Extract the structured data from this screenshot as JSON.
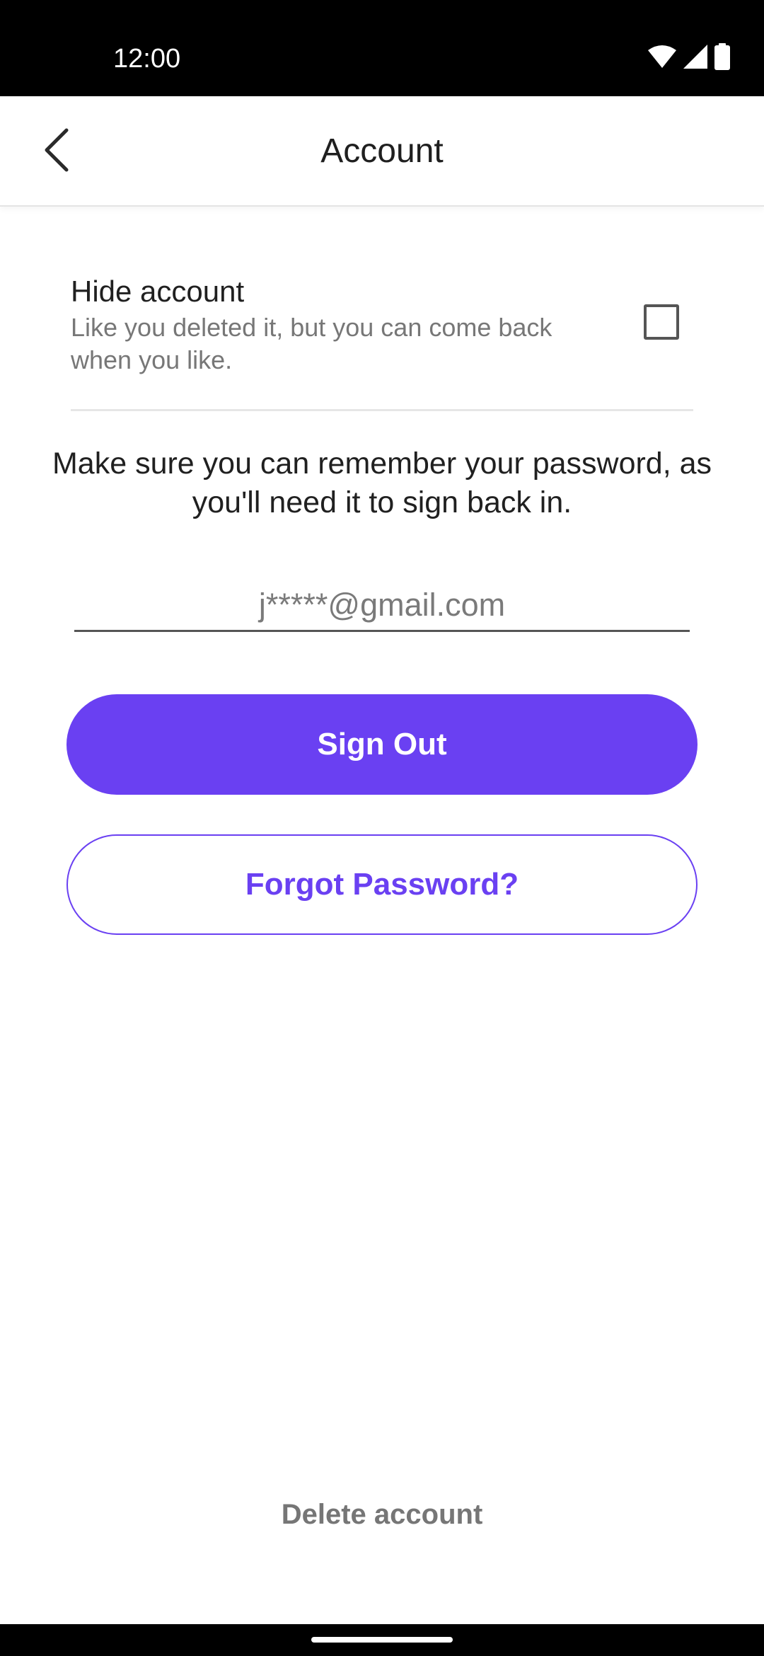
{
  "status_bar": {
    "time": "12:00",
    "icons": [
      "wifi-icon",
      "cellular-signal-icon",
      "battery-icon"
    ],
    "background": "#000000"
  },
  "app_bar": {
    "title": "Account",
    "back_icon": "chevron-left-icon"
  },
  "hide_account": {
    "title": "Hide account",
    "description": "Like you deleted it, but you can come back when you like.",
    "checked": false
  },
  "notice": "Make sure you can remember your password, as you'll need it to sign back in.",
  "email_field": {
    "placeholder": "j*****@gmail.com",
    "value": ""
  },
  "buttons": {
    "sign_out": "Sign Out",
    "forgot_password": "Forgot Password?"
  },
  "delete_account": "Delete account",
  "colors": {
    "accent": "#6a40f2",
    "text_primary": "#202020",
    "text_secondary": "#777777"
  }
}
